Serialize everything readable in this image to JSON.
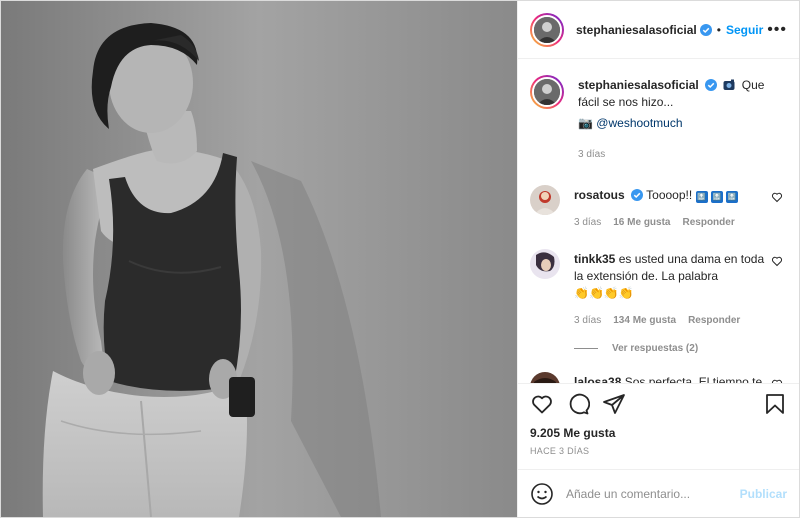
{
  "post": {
    "username": "stephaniesalasoficial",
    "follow_label": "Seguir",
    "dot": "•"
  },
  "caption": {
    "username": "stephaniesalasoficial",
    "text": "Que fácil se nos hizo...",
    "camera_emoji": "📷",
    "credit": "@weshootmuch",
    "time": "3 días"
  },
  "comments": [
    {
      "username": "rosatous",
      "verified": true,
      "text": "Toooop!! ",
      "badges": [
        "🔝",
        "🔝",
        "🔝"
      ],
      "time": "3 días",
      "likes": "16 Me gusta",
      "reply": "Responder"
    },
    {
      "username": "tinkk35",
      "verified": false,
      "text": "es usted una dama en toda la extensión de. La palabra",
      "emojis": "👏👏👏👏",
      "time": "3 días",
      "likes": "134 Me gusta",
      "reply": "Responder",
      "view_replies": "Ver respuestas (2)"
    },
    {
      "username": "lalosa38",
      "verified": false,
      "text": "Sos perfecta. El tiempo te dio la razón. Ave Maria"
    }
  ],
  "stats": {
    "likes": "9.205 Me gusta",
    "date": "HACE 3 DÍAS"
  },
  "add_comment": {
    "placeholder": "Añade un comentario...",
    "publish_label": "Publicar"
  },
  "colors": {
    "accent": "#0095f6",
    "publish_disabled": "#b2dffc",
    "verified": "#3897f0",
    "muted": "#8e8e8e"
  },
  "icons": [
    "more-options-icon",
    "verified-badge-icon",
    "heart-icon",
    "comment-icon",
    "share-icon",
    "bookmark-icon",
    "emoji-icon"
  ]
}
